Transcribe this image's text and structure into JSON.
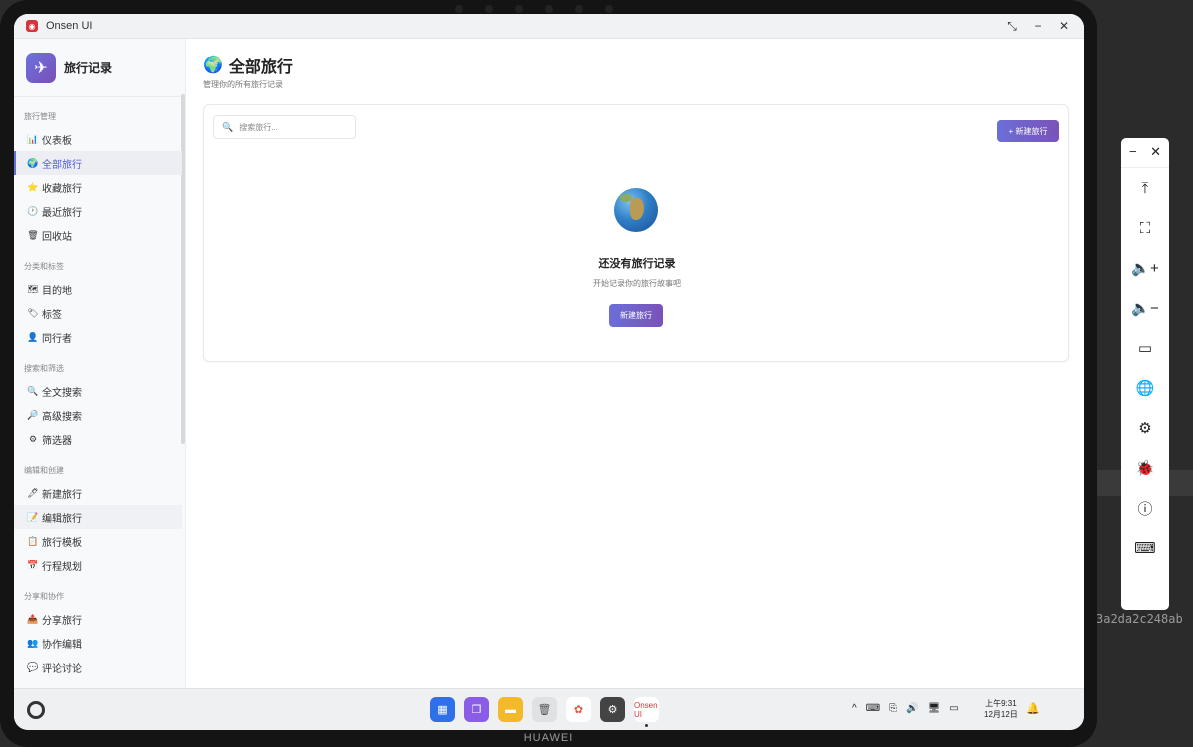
{
  "background": {
    "hash_text": "3a2da2c248ab"
  },
  "device": {
    "brand": "HUAWEI"
  },
  "window": {
    "title": "Onsen UI",
    "controls": [
      "⤡",
      "−",
      "✕"
    ]
  },
  "sidebar": {
    "app_title": "旅行记录",
    "sections": [
      {
        "title": "旅行管理",
        "items": [
          {
            "icon": "📊",
            "label": "仪表板"
          },
          {
            "icon": "🌍",
            "label": "全部旅行"
          },
          {
            "icon": "⭐",
            "label": "收藏旅行"
          },
          {
            "icon": "🕐",
            "label": "最近旅行"
          },
          {
            "icon": "🗑",
            "label": "回收站"
          }
        ]
      },
      {
        "title": "分类和标签",
        "items": [
          {
            "icon": "🗺",
            "label": "目的地"
          },
          {
            "icon": "🏷",
            "label": "标签"
          },
          {
            "icon": "👤",
            "label": "同行者"
          }
        ]
      },
      {
        "title": "搜索和筛选",
        "items": [
          {
            "icon": "🔍",
            "label": "全文搜索"
          },
          {
            "icon": "🔎",
            "label": "高级搜索"
          },
          {
            "icon": "⚙",
            "label": "筛选器"
          }
        ]
      },
      {
        "title": "编辑和创建",
        "items": [
          {
            "icon": "🖊",
            "label": "新建旅行"
          },
          {
            "icon": "📝",
            "label": "编辑旅行"
          },
          {
            "icon": "📋",
            "label": "旅行模板"
          },
          {
            "icon": "📅",
            "label": "行程规划"
          }
        ]
      },
      {
        "title": "分享和协作",
        "items": [
          {
            "icon": "📤",
            "label": "分享旅行"
          },
          {
            "icon": "👥",
            "label": "协作编辑"
          },
          {
            "icon": "💬",
            "label": "评论讨论"
          }
        ]
      }
    ]
  },
  "main": {
    "title_icon": "🌍",
    "title": "全部旅行",
    "subtitle": "管理你的所有旅行记录",
    "search_placeholder": "搜索旅行...",
    "new_button": "+ 新建旅行",
    "empty": {
      "title": "还没有旅行记录",
      "desc": "开始记录你的旅行故事吧",
      "button": "新建旅行"
    }
  },
  "taskbar": {
    "apps": [
      {
        "name": "grid-app",
        "glyph": "▦"
      },
      {
        "name": "window-app",
        "glyph": "❐"
      },
      {
        "name": "notes-app",
        "glyph": "▬"
      },
      {
        "name": "trash-app",
        "glyph": "🗑"
      },
      {
        "name": "photos-app",
        "glyph": "✿"
      },
      {
        "name": "settings-app",
        "glyph": "⚙"
      },
      {
        "name": "onsen-app",
        "glyph": "Onsen UI"
      }
    ],
    "tray": [
      "^",
      "⌨",
      "⎘",
      "🔊",
      "🖥",
      "▭"
    ],
    "time": "上午9:31",
    "date": "12月12日"
  },
  "float_toolbar": {
    "top": [
      "−",
      "✕"
    ],
    "tools": [
      {
        "name": "upload-icon",
        "glyph": "⤒"
      },
      {
        "name": "crop-icon",
        "glyph": "⛶"
      },
      {
        "name": "volume-up-icon",
        "glyph": "🔈+"
      },
      {
        "name": "volume-down-icon",
        "glyph": "🔈−"
      },
      {
        "name": "battery-icon",
        "glyph": "▭"
      },
      {
        "name": "globe-icon",
        "glyph": "🌐"
      },
      {
        "name": "settings-icon",
        "glyph": "⚙"
      },
      {
        "name": "bug-icon",
        "glyph": "🐞"
      },
      {
        "name": "info-icon",
        "glyph": "ⓘ"
      },
      {
        "name": "keyboard-icon",
        "glyph": "⌨"
      }
    ]
  }
}
